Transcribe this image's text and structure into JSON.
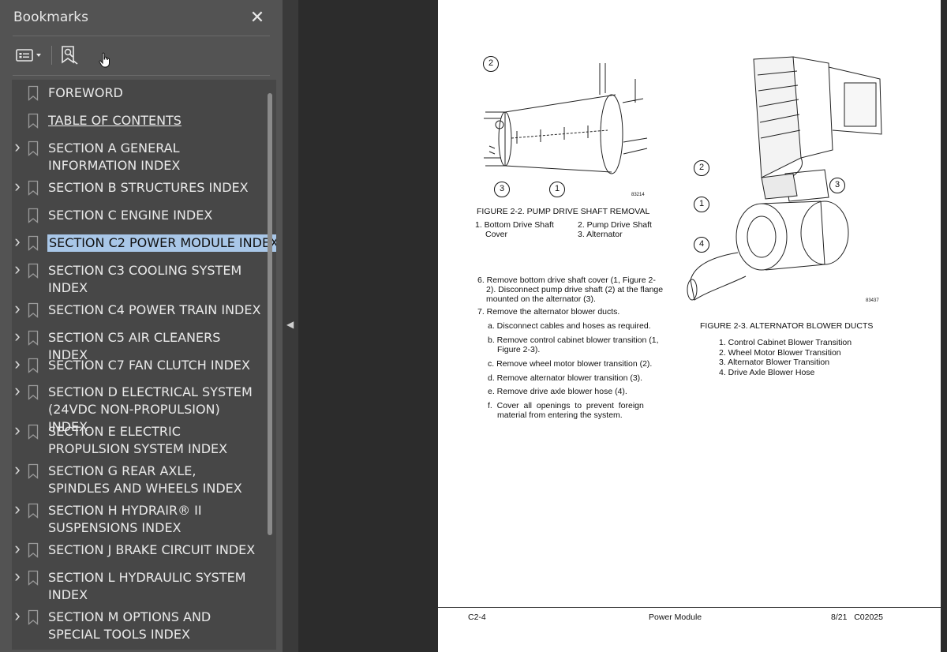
{
  "bookmarks_panel": {
    "title": "Bookmarks",
    "close_icon": "close-icon",
    "toolbar": {
      "options_icon": "options-menu-icon",
      "find_bookmark_icon": "find-current-bookmark-icon"
    },
    "items": [
      {
        "label": "FOREWORD",
        "expandable": false,
        "selected": false
      },
      {
        "label": "TABLE OF CONTENTS",
        "expandable": false,
        "selected": false,
        "underline": true
      },
      {
        "label": "SECTION A GENERAL INFORMATION INDEX",
        "expandable": true,
        "selected": false
      },
      {
        "label": "SECTION B STRUCTURES INDEX",
        "expandable": true,
        "selected": false
      },
      {
        "label": "SECTION C ENGINE INDEX",
        "expandable": false,
        "selected": false
      },
      {
        "label": "SECTION C2 POWER MODULE INDEX",
        "expandable": true,
        "selected": true
      },
      {
        "label": "SECTION C3 COOLING SYSTEM INDEX",
        "expandable": true,
        "selected": false
      },
      {
        "label": "SECTION C4 POWER TRAIN INDEX",
        "expandable": true,
        "selected": false
      },
      {
        "label": "SECTION C5 AIR CLEANERS INDEX",
        "expandable": true,
        "selected": false
      },
      {
        "label": "SECTION C7 FAN CLUTCH INDEX",
        "expandable": true,
        "selected": false
      },
      {
        "label": "SECTION D ELECTRICAL SYSTEM (24VDC NON-PROPULSION) INDEX",
        "expandable": true,
        "selected": false
      },
      {
        "label": "SECTION E ELECTRIC PROPULSION SYSTEM INDEX",
        "expandable": true,
        "selected": false
      },
      {
        "label": "SECTION G REAR AXLE, SPINDLES AND WHEELS INDEX",
        "expandable": true,
        "selected": false
      },
      {
        "label": "SECTION H HYDRAIR® II SUSPENSIONS INDEX",
        "expandable": true,
        "selected": false
      },
      {
        "label": "SECTION J BRAKE CIRCUIT INDEX",
        "expandable": true,
        "selected": false
      },
      {
        "label": "SECTION L HYDRAULIC SYSTEM INDEX",
        "expandable": true,
        "selected": false
      },
      {
        "label": "SECTION M OPTIONS AND SPECIAL TOOLS INDEX",
        "expandable": true,
        "selected": false
      }
    ]
  },
  "document": {
    "figure1": {
      "caption": "FIGURE 2-2. PUMP DRIVE SHAFT REMOVAL",
      "number": "83214",
      "legend_col1_a": "1. Bottom Drive Shaft",
      "legend_col1_b": "Cover",
      "legend_col2": "2. Pump Drive Shaft",
      "legend_col2_b": "3. Alternator",
      "callouts": [
        "2",
        "3",
        "1"
      ]
    },
    "figure2": {
      "caption": "FIGURE 2-3. ALTERNATOR BLOWER DUCTS",
      "number": "83437",
      "legend": [
        "1. Control Cabinet Blower Transition",
        "2. Wheel Motor Blower Transition",
        "3. Alternator Blower Transition",
        "4. Drive Axle Blower Hose"
      ],
      "callouts": [
        "2",
        "3",
        "1",
        "4"
      ]
    },
    "steps": {
      "s6_l1": "6. Remove bottom drive shaft cover (1, Figure 2-",
      "s6_l2": "2). Disconnect pump drive shaft (2) at the flange",
      "s6_l3": "mounted on the alternator (3).",
      "s7": "7. Remove the alternator blower ducts.",
      "a": "a. Disconnect cables and hoses as required.",
      "b_l1": "b. Remove control cabinet blower transition (1,",
      "b_l2": "Figure 2-3).",
      "c": "c. Remove wheel motor blower transition (2).",
      "d": "d. Remove alternator blower transition (3).",
      "e": "e. Remove drive axle blower hose (4).",
      "f_l1": "f.  Cover  all  openings  to  prevent  foreign",
      "f_l2": "material from entering the system."
    },
    "footer": {
      "left": "C2-4",
      "center": "Power Module",
      "right": "8/21   C02025"
    }
  }
}
